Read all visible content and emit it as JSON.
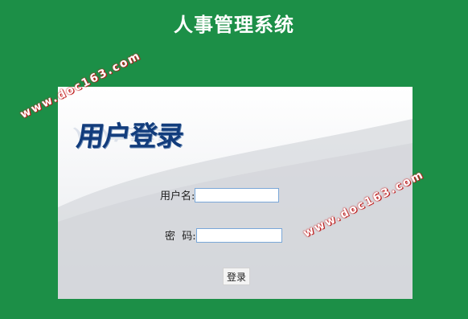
{
  "window": {
    "title": "人事管理系统"
  },
  "login": {
    "heading": "用户登录",
    "username_label": "用户名:",
    "username_value": "",
    "password_label": "密  码:",
    "password_value": "",
    "submit_label": "登录"
  },
  "watermarks": [
    "www.doc163.com",
    "www.doc163.com"
  ],
  "colors": {
    "background": "#1c8f47",
    "heading": "#123c7c",
    "watermark_outline": "#cc2222",
    "input_border": "#7aa7d8"
  }
}
